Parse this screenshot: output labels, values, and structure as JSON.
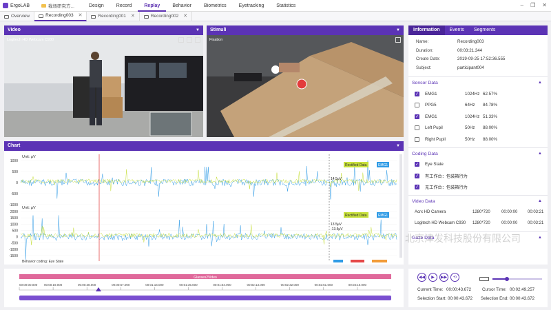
{
  "app": {
    "name": "ErgoLAB",
    "project": "我场研究方..."
  },
  "menu": [
    "Design",
    "Record",
    "Replay",
    "Behavior",
    "Biometrics",
    "Eyetracking",
    "Statistics"
  ],
  "menu_active": "Replay",
  "window_controls": [
    "–",
    "❐",
    "✕"
  ],
  "tabs": [
    {
      "label": "Overview"
    },
    {
      "label": "Recording003",
      "close": "✕"
    },
    {
      "label": "Recording001",
      "close": "✕"
    },
    {
      "label": "Recording002",
      "close": "✕"
    }
  ],
  "video": {
    "title": "Video",
    "camera_label": "Logitech HD Webcam C930"
  },
  "stimuli": {
    "title": "Stimuli",
    "label": "Fixation"
  },
  "chart": {
    "title": "Chart",
    "unit_top": "Unit: μV",
    "unit_bottom": "Unit: μV",
    "tag_rectified": "Rectified Data",
    "tag_emg": "EMG1",
    "readout_top": "14.5μV",
    "readout_bottom_1": "13.5μV",
    "readout_bottom_2": "-13.5μV",
    "footer": "Behavior coding: Eye State"
  },
  "chart_data": [
    {
      "type": "line",
      "series": [
        {
          "name": "Rectified Data"
        },
        {
          "name": "EMG1"
        }
      ],
      "yticks": [
        "1000",
        "500",
        "0",
        "-500",
        "-1000"
      ],
      "ylim": [
        -1000,
        1000
      ]
    },
    {
      "type": "line",
      "series": [
        {
          "name": "Rectified Data"
        },
        {
          "name": "EMG1"
        }
      ],
      "yticks": [
        "2000",
        "1500",
        "1000",
        "500",
        "0",
        "-500",
        "-1000",
        "-1500"
      ],
      "ylim": [
        -1500,
        2000
      ]
    }
  ],
  "timeline": {
    "track_label": "Glasses2Video",
    "ticks": [
      "00:00:00.000",
      "00:00:19.000",
      "00:00:38.000",
      "00:00:57.000",
      "00:01:16.000",
      "00:01:35.000",
      "00:01:54.000",
      "00:02:13.000",
      "00:02:32.000",
      "00:02:51.000",
      "00:03:10.000"
    ]
  },
  "info_tabs": [
    "Information",
    "Events",
    "Segments"
  ],
  "information": [
    {
      "k": "Name:",
      "v": "Recording003"
    },
    {
      "k": "Duration:",
      "v": "00:03:21.344"
    },
    {
      "k": "Create Date:",
      "v": "2019-09-25 17:52:36.555"
    },
    {
      "k": "Subject:",
      "v": "participant004"
    }
  ],
  "sensor_section": "Sensor Data",
  "sensors": [
    {
      "name": "EMG1",
      "hz": "1024Hz",
      "pct": "62.57%",
      "checked": true
    },
    {
      "name": "PPG5",
      "hz": "64Hz",
      "pct": "84.78%",
      "checked": false
    },
    {
      "name": "EMG1",
      "hz": "1024Hz",
      "pct": "51.33%",
      "checked": true
    },
    {
      "name": "Left Pupil",
      "hz": "50Hz",
      "pct": "88.00%",
      "checked": false
    },
    {
      "name": "Right Pupil",
      "hz": "50Hz",
      "pct": "88.00%",
      "checked": false
    }
  ],
  "coding_section": "Coding Data",
  "coding": [
    {
      "name": "Eye State",
      "checked": true
    },
    {
      "name": "有工作台：包装箱行为",
      "checked": true
    },
    {
      "name": "无工作台：包装箱行为",
      "checked": true
    }
  ],
  "video_section": "Video Data",
  "videos": [
    {
      "name": "Acrx HD Camera",
      "res": "1280*720",
      "t1": "00:00:00",
      "t2": "00:03:21"
    },
    {
      "name": "Logitech HD Webcam C930",
      "res": "1280*720",
      "t1": "00:00:00",
      "t2": "00:03:21"
    }
  ],
  "gaze_section": "Gaze Data",
  "playback": {
    "current_label": "Current Time:",
    "current": "00:00:43.672",
    "cursor_label": "Cursor Time:",
    "cursor": "00:02:49.257",
    "sel_start_label": "Selection Start:",
    "sel_start": "00:00:43.672",
    "sel_end_label": "Selection End:",
    "sel_end": "00:00:43.672"
  },
  "watermark": "北京津发科技股份有限公司",
  "colors": {
    "accent": "#5b33b5",
    "emg": "#2f9be6",
    "rectified": "#c6df3a",
    "cursor": "#e54848",
    "timeline_pink": "#e0699b"
  }
}
